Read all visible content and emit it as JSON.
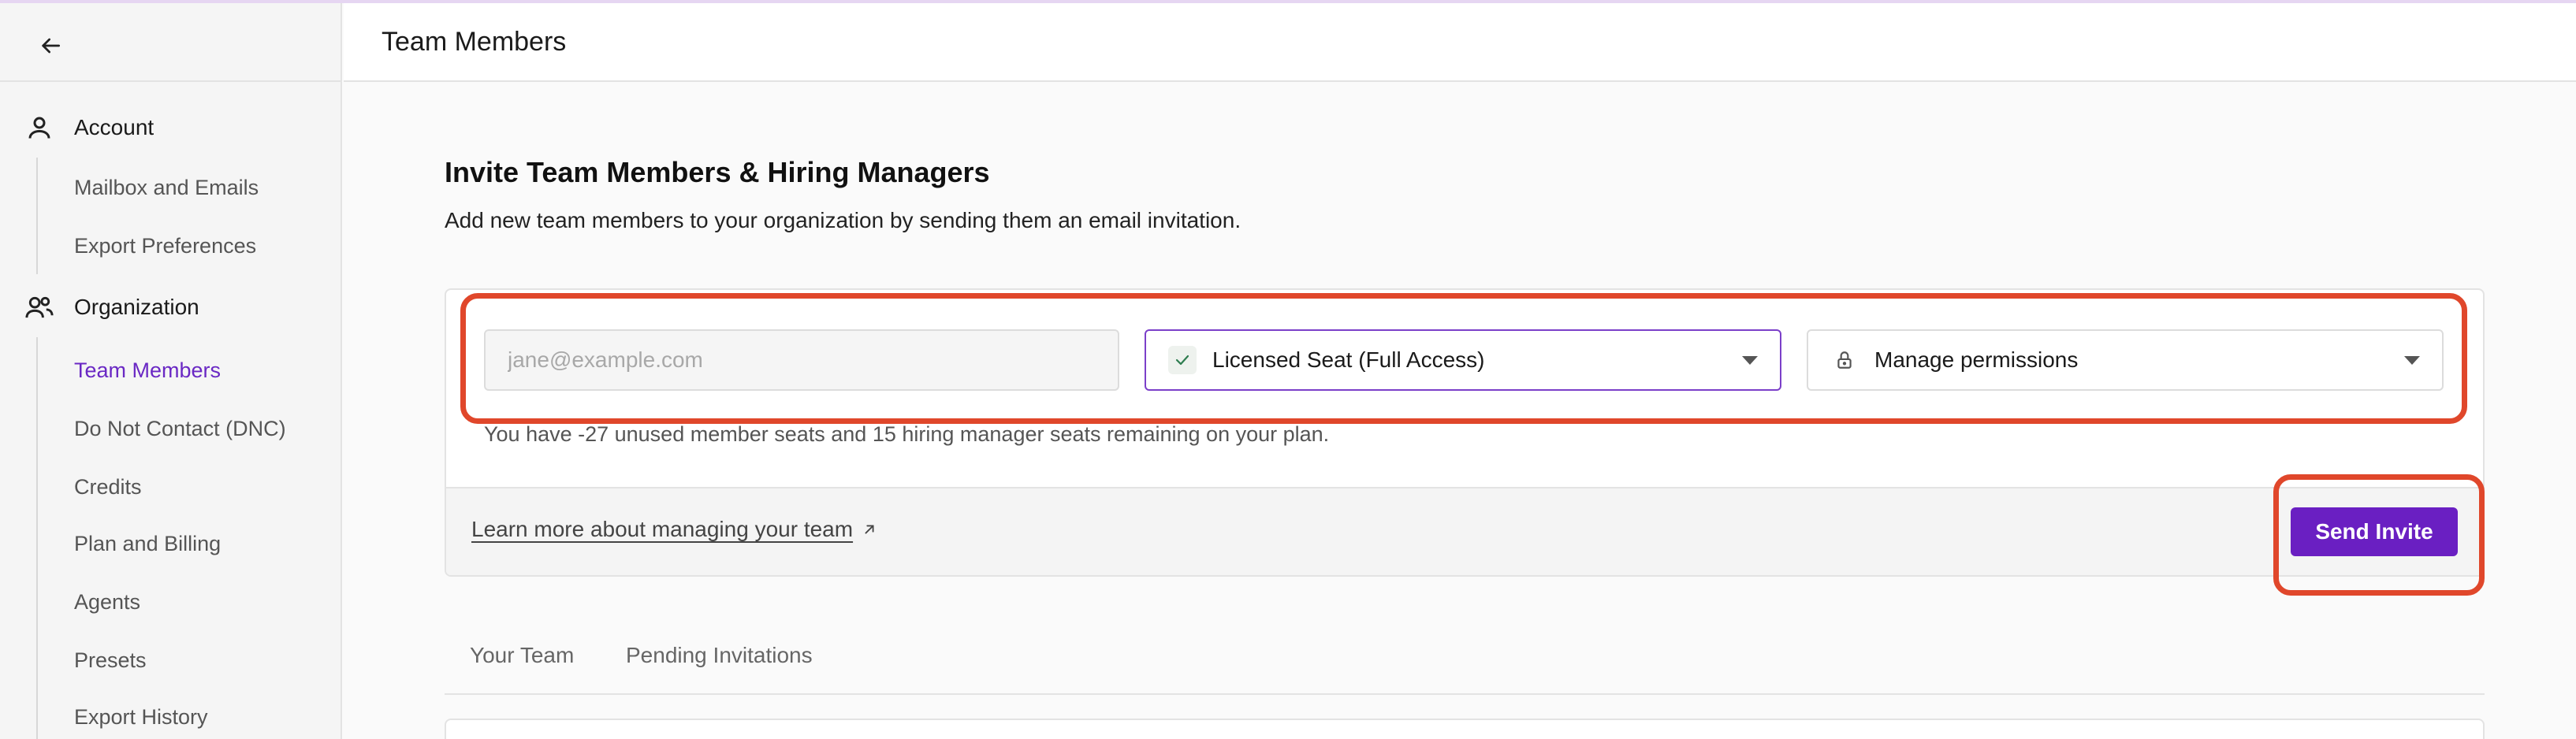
{
  "header": {
    "title": "Team Members"
  },
  "sidebar": {
    "back_label": "Back",
    "sections": [
      {
        "label": "Account",
        "icon": "person-icon",
        "items": [
          "Mailbox and Emails",
          "Export Preferences"
        ]
      },
      {
        "label": "Organization",
        "icon": "people-icon",
        "items": [
          "Team Members",
          "Do Not Contact (DNC)",
          "Credits",
          "Plan and Billing",
          "Agents",
          "Presets",
          "Export History"
        ]
      }
    ],
    "active_item": "Team Members"
  },
  "invite": {
    "title": "Invite Team Members & Hiring Managers",
    "subtitle": "Add new team members to your organization by sending them an email invitation.",
    "email_placeholder": "jane@example.com",
    "seat_value": "Licensed Seat (Full Access)",
    "permissions_value": "Manage permissions",
    "seats_note": "You have -27 unused member seats and 15 hiring manager seats remaining on your plan.",
    "learn_more": "Learn more about managing your team",
    "send_label": "Send Invite"
  },
  "tabs": [
    "Your Team",
    "Pending Invitations"
  ],
  "colors": {
    "accent": "#6a1fc2",
    "highlight": "#e0472b"
  }
}
